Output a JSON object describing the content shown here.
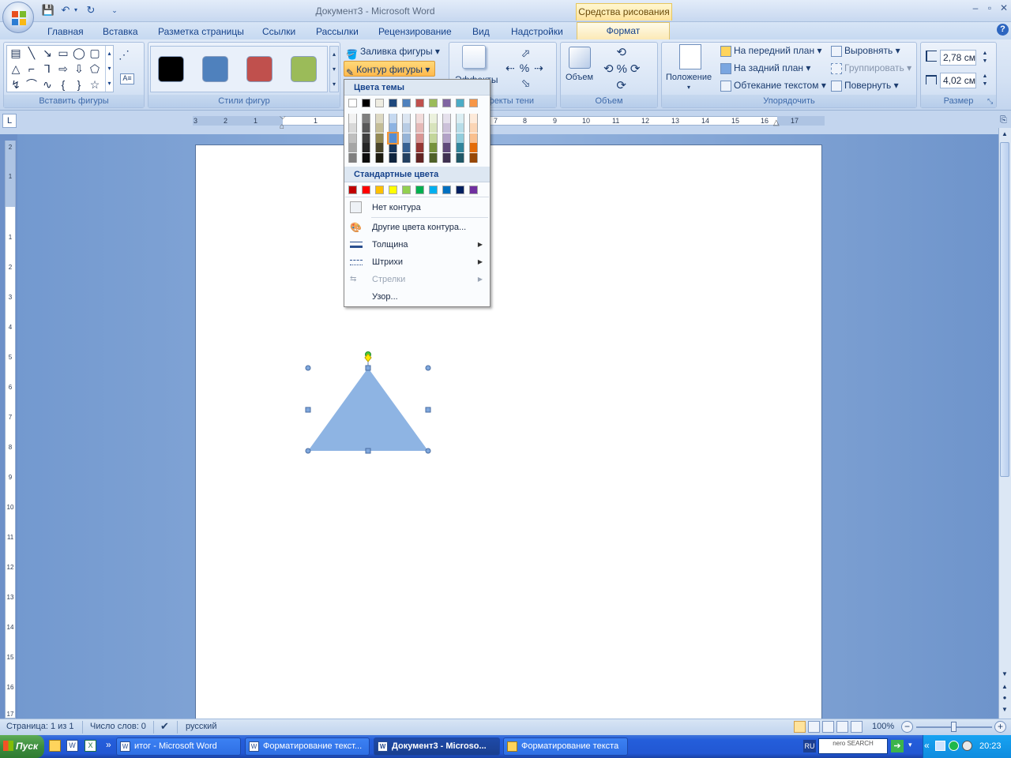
{
  "window": {
    "title": "Документ3 - Microsoft Word",
    "context_header": "Средства рисования"
  },
  "tabs": [
    "Главная",
    "Вставка",
    "Разметка страницы",
    "Ссылки",
    "Рассылки",
    "Рецензирование",
    "Вид",
    "Надстройки"
  ],
  "active_tab": "Формат",
  "ribbon": {
    "groups": {
      "insert_shapes": "Вставить фигуры",
      "shape_styles": "Стили фигур",
      "shadow_effects_partial": "ффекты тени",
      "effects_partial": "Эффекты",
      "volume": "Объем",
      "arrange": "Упорядочить",
      "size": "Размер"
    },
    "shape_fill": "Заливка фигуры",
    "shape_outline": "Контур фигуры",
    "volume_btn": "Объем",
    "position_btn": "Положение",
    "bring_front": "На передний план",
    "send_back": "На задний план",
    "text_wrap": "Обтекание текстом",
    "align": "Выровнять",
    "group": "Группировать",
    "rotate": "Повернуть",
    "height_value": "2,78 см",
    "width_value": "4,02 см",
    "style_colors": [
      "#000000",
      "#4f81bd",
      "#c0504d",
      "#9bbb59"
    ]
  },
  "dropdown": {
    "theme_header": "Цвета темы",
    "standard_header": "Стандартные цвета",
    "theme_colors": [
      [
        "#ffffff",
        "#f2f2f2",
        "#d8d8d8",
        "#bfbfbf",
        "#a5a5a5",
        "#7f7f7f"
      ],
      [
        "#000000",
        "#7f7f7f",
        "#595959",
        "#3f3f3f",
        "#262626",
        "#0c0c0c"
      ],
      [
        "#eeece1",
        "#ddd9c3",
        "#c4bd97",
        "#948a54",
        "#4a452a",
        "#1d1b10"
      ],
      [
        "#1f497d",
        "#c6d9f0",
        "#8db3e2",
        "#548dd4",
        "#17365d",
        "#0f243e"
      ],
      [
        "#4f81bd",
        "#dbe5f1",
        "#b8cce4",
        "#95b3d7",
        "#366092",
        "#244061"
      ],
      [
        "#c0504d",
        "#f2dcdb",
        "#e5b9b7",
        "#d99694",
        "#953734",
        "#632423"
      ],
      [
        "#9bbb59",
        "#ebf1dd",
        "#d7e3bc",
        "#c3d69b",
        "#76923c",
        "#4f6128"
      ],
      [
        "#8064a2",
        "#e5e0ec",
        "#ccc1d9",
        "#b2a2c7",
        "#5f497a",
        "#3f3151"
      ],
      [
        "#4bacc6",
        "#dbeef3",
        "#b7dde8",
        "#92cddc",
        "#31859b",
        "#205867"
      ],
      [
        "#f79646",
        "#fdeada",
        "#fbd5b5",
        "#fac08f",
        "#e36c09",
        "#974806"
      ]
    ],
    "selected_theme_color": "#548dd4",
    "standard_colors": [
      "#c00000",
      "#ff0000",
      "#ffc000",
      "#ffff00",
      "#92d050",
      "#00b050",
      "#00b0f0",
      "#0070c0",
      "#002060",
      "#7030a0"
    ],
    "no_outline": "Нет контура",
    "more_colors": "Другие цвета контура...",
    "weight": "Толщина",
    "dashes": "Штрихи",
    "arrows": "Стрелки",
    "pattern": "Узор..."
  },
  "ruler": {
    "h_ticks": [
      "3",
      "2",
      "1",
      "1",
      "2",
      "3",
      "4",
      "5",
      "6",
      "7",
      "8",
      "9",
      "10",
      "11",
      "12",
      "13",
      "14",
      "15",
      "16",
      "17"
    ],
    "v_ticks": [
      "2",
      "1",
      "1",
      "2",
      "3",
      "4",
      "5",
      "6",
      "7",
      "8",
      "9",
      "10",
      "11",
      "12",
      "13",
      "14",
      "15",
      "16",
      "17"
    ]
  },
  "document": {
    "shape": "triangle",
    "shape_fill": "#8eb4e3"
  },
  "statusbar": {
    "page": "Страница: 1 из 1",
    "words": "Число слов: 0",
    "language": "русский",
    "zoom": "100%"
  },
  "taskbar": {
    "start": "Пуск",
    "tasks": [
      "итог - Microsoft Word",
      "Форматирование текст...",
      "Документ3 - Microso...",
      "Форматирование текста"
    ],
    "active_task": 2,
    "lang": "RU",
    "search_brand": "nero SEARCH",
    "clock": "20:23"
  }
}
